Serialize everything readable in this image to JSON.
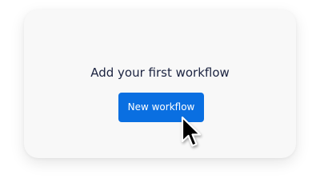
{
  "empty_state": {
    "title": "Add your first workflow",
    "button_label": "New workflow"
  },
  "colors": {
    "button_background": "#0a6fe1",
    "title_text": "#1b2340",
    "card_background": "#f8f8f8"
  },
  "icons": {
    "cursor": "arrow-cursor-icon"
  }
}
